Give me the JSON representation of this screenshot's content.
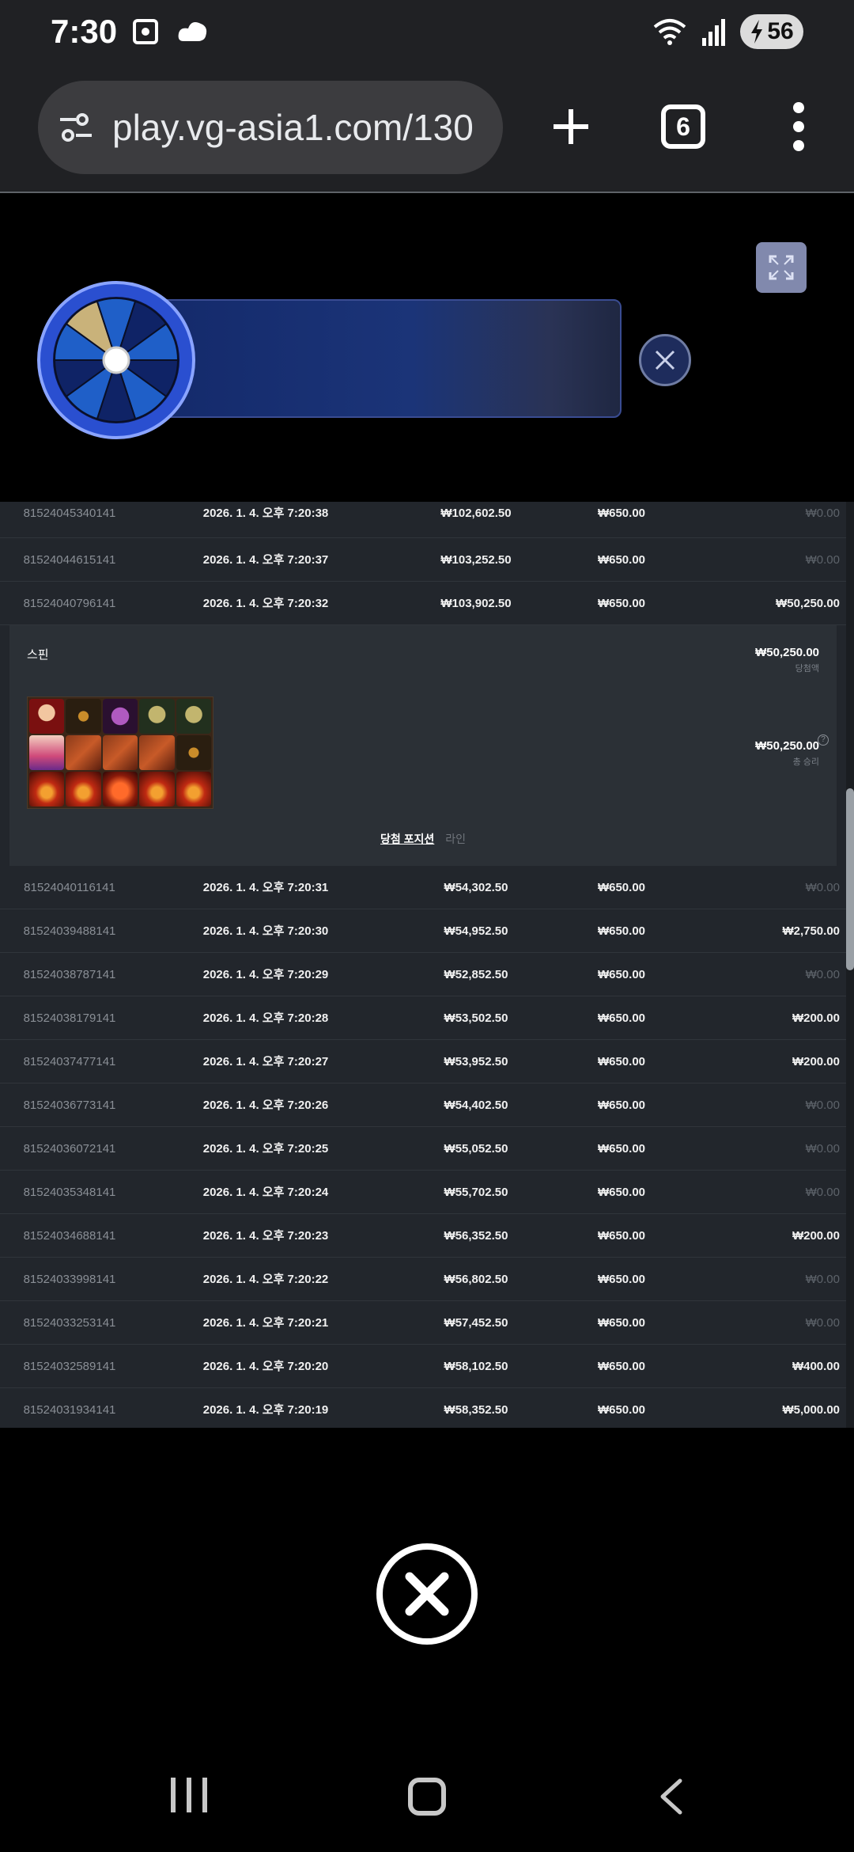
{
  "status_bar": {
    "time": "7:30",
    "battery": "56",
    "icons": [
      "screenshot-icon",
      "cloud-icon",
      "wifi-icon",
      "signal-icon",
      "battery-charging-icon"
    ]
  },
  "browser": {
    "url": "play.vg-asia1.com/130",
    "tab_count": "6"
  },
  "history": {
    "rows_top": [
      {
        "id": "81524045340141",
        "date": "2026. 1. 4. 오후 7:20:38",
        "balance": "₩102,602.50",
        "bet": "₩650.00",
        "win": "₩0.00",
        "zero": true
      },
      {
        "id": "81524044615141",
        "date": "2026. 1. 4. 오후 7:20:37",
        "balance": "₩103,252.50",
        "bet": "₩650.00",
        "win": "₩0.00",
        "zero": true
      },
      {
        "id": "81524040796141",
        "date": "2026. 1. 4. 오후 7:20:32",
        "balance": "₩103,902.50",
        "bet": "₩650.00",
        "win": "₩50,250.00",
        "zero": false
      }
    ],
    "detail": {
      "label": "스핀",
      "win_amount": "₩50,250.00",
      "win_label": "당첨액",
      "total_amount": "₩50,250.00",
      "total_label": "총 승리",
      "help": "?",
      "tab_positions": "당첨 포지션",
      "tab_lines": "라인"
    },
    "rows_bottom": [
      {
        "id": "81524040116141",
        "date": "2026. 1. 4. 오후 7:20:31",
        "balance": "₩54,302.50",
        "bet": "₩650.00",
        "win": "₩0.00",
        "zero": true
      },
      {
        "id": "81524039488141",
        "date": "2026. 1. 4. 오후 7:20:30",
        "balance": "₩54,952.50",
        "bet": "₩650.00",
        "win": "₩2,750.00",
        "zero": false
      },
      {
        "id": "81524038787141",
        "date": "2026. 1. 4. 오후 7:20:29",
        "balance": "₩52,852.50",
        "bet": "₩650.00",
        "win": "₩0.00",
        "zero": true
      },
      {
        "id": "81524038179141",
        "date": "2026. 1. 4. 오후 7:20:28",
        "balance": "₩53,502.50",
        "bet": "₩650.00",
        "win": "₩200.00",
        "zero": false
      },
      {
        "id": "81524037477141",
        "date": "2026. 1. 4. 오후 7:20:27",
        "balance": "₩53,952.50",
        "bet": "₩650.00",
        "win": "₩200.00",
        "zero": false
      },
      {
        "id": "81524036773141",
        "date": "2026. 1. 4. 오후 7:20:26",
        "balance": "₩54,402.50",
        "bet": "₩650.00",
        "win": "₩0.00",
        "zero": true
      },
      {
        "id": "81524036072141",
        "date": "2026. 1. 4. 오후 7:20:25",
        "balance": "₩55,052.50",
        "bet": "₩650.00",
        "win": "₩0.00",
        "zero": true
      },
      {
        "id": "81524035348141",
        "date": "2026. 1. 4. 오후 7:20:24",
        "balance": "₩55,702.50",
        "bet": "₩650.00",
        "win": "₩0.00",
        "zero": true
      },
      {
        "id": "81524034688141",
        "date": "2026. 1. 4. 오후 7:20:23",
        "balance": "₩56,352.50",
        "bet": "₩650.00",
        "win": "₩200.00",
        "zero": false
      },
      {
        "id": "81524033998141",
        "date": "2026. 1. 4. 오후 7:20:22",
        "balance": "₩56,802.50",
        "bet": "₩650.00",
        "win": "₩0.00",
        "zero": true
      },
      {
        "id": "81524033253141",
        "date": "2026. 1. 4. 오후 7:20:21",
        "balance": "₩57,452.50",
        "bet": "₩650.00",
        "win": "₩0.00",
        "zero": true
      },
      {
        "id": "81524032589141",
        "date": "2026. 1. 4. 오후 7:20:20",
        "balance": "₩58,102.50",
        "bet": "₩650.00",
        "win": "₩400.00",
        "zero": false
      },
      {
        "id": "81524031934141",
        "date": "2026. 1. 4. 오후 7:20:19",
        "balance": "₩58,352.50",
        "bet": "₩650.00",
        "win": "₩5,000.00",
        "zero": false
      }
    ]
  },
  "reel_symbols": [
    "vamp",
    "cross",
    "orb",
    "skull",
    "skull",
    "bonus",
    "book",
    "book",
    "book",
    "cross",
    "fire",
    "fire",
    "logo",
    "fire",
    "fire"
  ]
}
